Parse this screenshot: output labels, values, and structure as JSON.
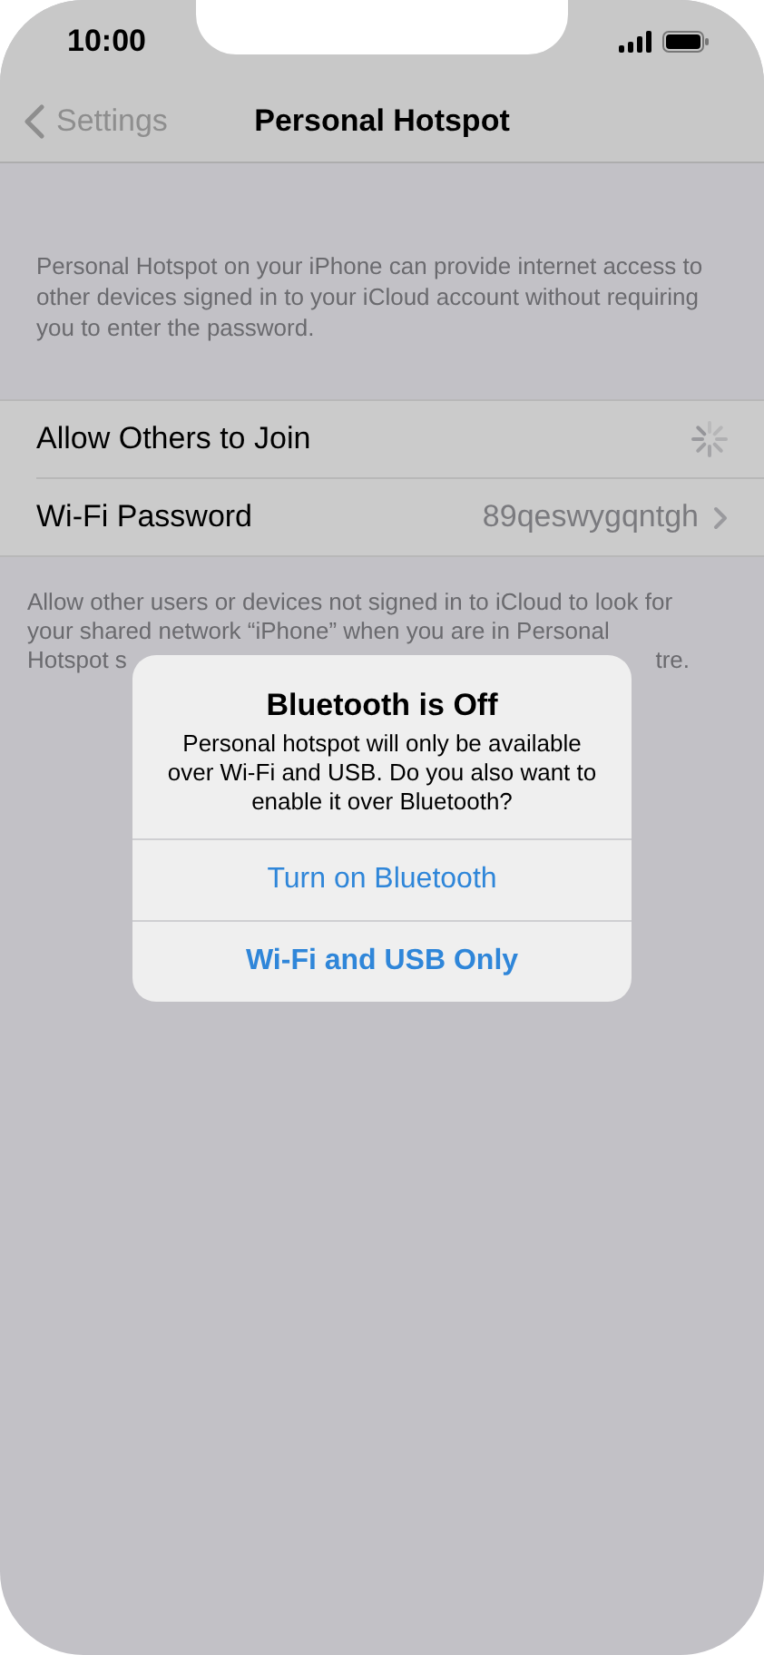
{
  "status_bar": {
    "time": "10:00"
  },
  "nav": {
    "back": "Settings",
    "title": "Personal Hotspot"
  },
  "header_text": "Personal Hotspot on your iPhone can provide internet access to other devices signed in to your iCloud account without requiring you to enter the password.",
  "rows": [
    {
      "kind": "loading",
      "label": "Allow Others to Join"
    },
    {
      "kind": "value",
      "label": "Wi-Fi Password",
      "value": "89qeswygqntgh"
    }
  ],
  "footer_lines": [
    "Allow other users or devices not signed in to iCloud to look for",
    "your shared network “iPhone” when you are in Personal"
  ],
  "footer_fragments": [
    "Hotspot s",
    "tre."
  ],
  "alert": {
    "title": "Bluetooth is Off",
    "message": "Personal hotspot will only be available over Wi-Fi and USB. Do you also want to enable it over Bluetooth?",
    "buttons": [
      {
        "label": "Turn on Bluetooth",
        "kind": "default"
      },
      {
        "label": "Wi-Fi and USB Only",
        "kind": "preferred"
      }
    ]
  }
}
